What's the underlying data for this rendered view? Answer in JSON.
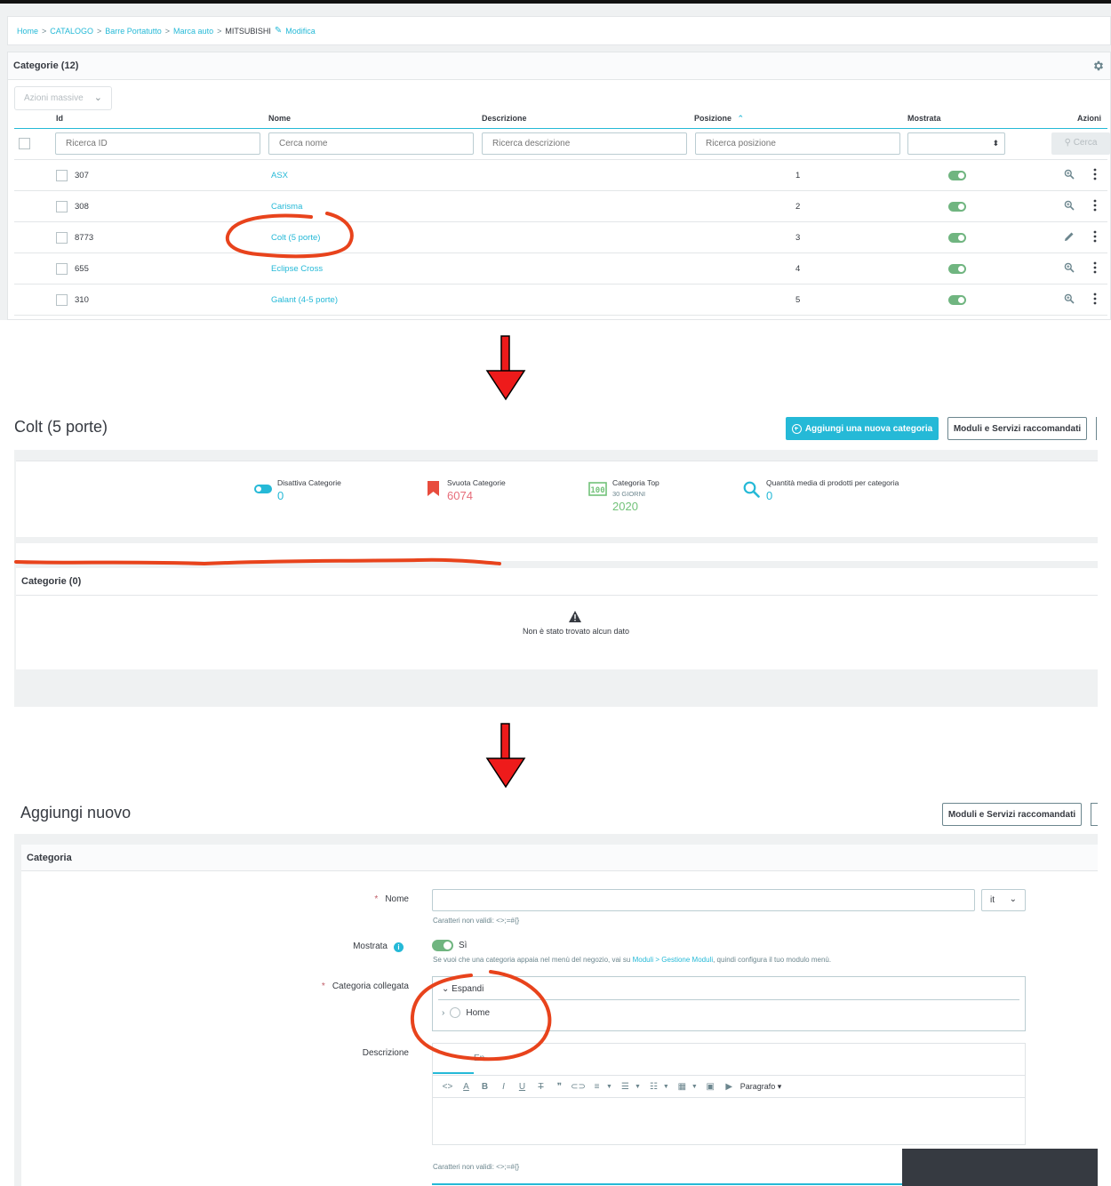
{
  "breadcrumb": {
    "items": [
      "Home",
      "CATALOGO",
      "Barre Portatutto",
      "Marca auto"
    ],
    "current": "MITSUBISHI",
    "edit_label": "Modifica"
  },
  "list": {
    "title": "Categorie (12)",
    "bulk_actions": "Azioni massive",
    "columns": {
      "id": "Id",
      "name": "Nome",
      "description": "Descrizione",
      "position": "Posizione",
      "shown": "Mostrata",
      "actions": "Azioni"
    },
    "filters": {
      "id_placeholder": "Ricerca ID",
      "name_placeholder": "Cerca nome",
      "description_placeholder": "Ricerca descrizione",
      "position_placeholder": "Ricerca posizione",
      "search_button": "Cerca"
    },
    "rows": [
      {
        "id": "307",
        "name": "ASX",
        "position": "1",
        "shown": true,
        "action_icon": "zoom-icon"
      },
      {
        "id": "308",
        "name": "Carisma",
        "position": "2",
        "shown": true,
        "action_icon": "zoom-icon"
      },
      {
        "id": "8773",
        "name": "Colt (5 porte)",
        "position": "3",
        "shown": true,
        "action_icon": "pencil-icon"
      },
      {
        "id": "655",
        "name": "Eclipse Cross",
        "position": "4",
        "shown": true,
        "action_icon": "zoom-icon"
      },
      {
        "id": "310",
        "name": "Galant (4-5 porte)",
        "position": "5",
        "shown": true,
        "action_icon": "zoom-icon"
      }
    ]
  },
  "category_page": {
    "title": "Colt (5 porte)",
    "add_button": "Aggiungi una nuova categoria",
    "recommended_button": "Moduli e Servizi raccomandati",
    "kpis": [
      {
        "label": "Disattiva Categorie",
        "sub": "",
        "value": "0",
        "color": "#25b9d7",
        "icon": "toggle-icon"
      },
      {
        "label": "Svuota Categorie",
        "sub": "",
        "value": "6074",
        "color": "#e76d7a",
        "icon": "bookmark-icon"
      },
      {
        "label": "Categoria Top",
        "sub": "30 GIORNI",
        "value": "2020",
        "color": "#72c279",
        "icon": "ranking-icon"
      },
      {
        "label": "Quantità media di prodotti per categoria",
        "sub": "",
        "value": "0",
        "color": "#25b9d7",
        "icon": "search-icon"
      }
    ],
    "subcategories_title": "Categorie (0)",
    "empty_text": "Non è stato trovato alcun dato"
  },
  "add_page": {
    "title": "Aggiungi nuovo",
    "recommended_button": "Moduli e Servizi raccomandati",
    "card_title": "Categoria",
    "name_label": "Nome",
    "lang": "it",
    "invalid_chars_hint": "Caratteri non validi: <>;=#{}",
    "shown_label": "Mostrata",
    "shown_value": "Sì",
    "menu_hint_pre": "Se vuoi che una categoria appaia nel menù del negozio, vai su ",
    "menu_hint_link": "Moduli > Gestione Moduli",
    "menu_hint_post": ", quindi configura il tuo modulo menù.",
    "parent_label": "Categoria collegata",
    "tree_expand": "Espandi",
    "tree_root": "Home",
    "description_label": "Descrizione",
    "description_tab": "En",
    "toolbar_paragraph": "Paragrafo",
    "invalid_chars_hint_2": "Caratteri non validi: <>;=#{}"
  },
  "colors": {
    "accent": "#25b9d7",
    "toggle_on": "#70b580",
    "annotation_red": "#e8431c",
    "arrow_red": "#ee1b1b"
  }
}
